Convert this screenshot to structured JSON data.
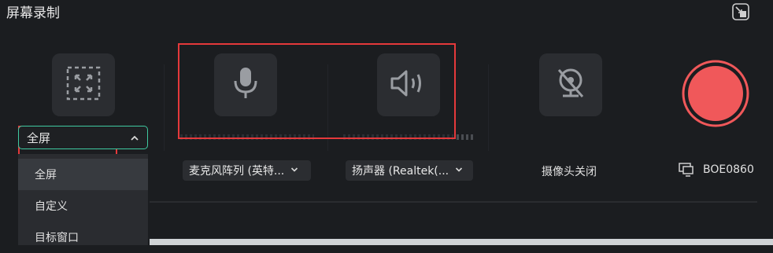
{
  "app": {
    "title": "屏幕录制"
  },
  "capture": {
    "mode_selected": "全屏",
    "mode_options": [
      "全屏",
      "自定义",
      "目标窗口"
    ]
  },
  "microphone": {
    "label": "麦克风阵列 (英特..."
  },
  "speaker": {
    "label": "扬声器 (Realtek(..."
  },
  "camera": {
    "label": "摄像头关闭"
  },
  "display": {
    "label": "BOE0860"
  },
  "colors": {
    "accent": "#3fc9a0",
    "record": "#f0585a",
    "highlight_box": "#e5393b"
  },
  "icons": {
    "minimize": "minimize-window-icon",
    "fullscreen": "fullscreen-area-icon",
    "microphone": "microphone-icon",
    "speaker": "speaker-icon",
    "camera": "camera-off-icon",
    "monitor": "monitor-icon",
    "record": "record-button"
  }
}
